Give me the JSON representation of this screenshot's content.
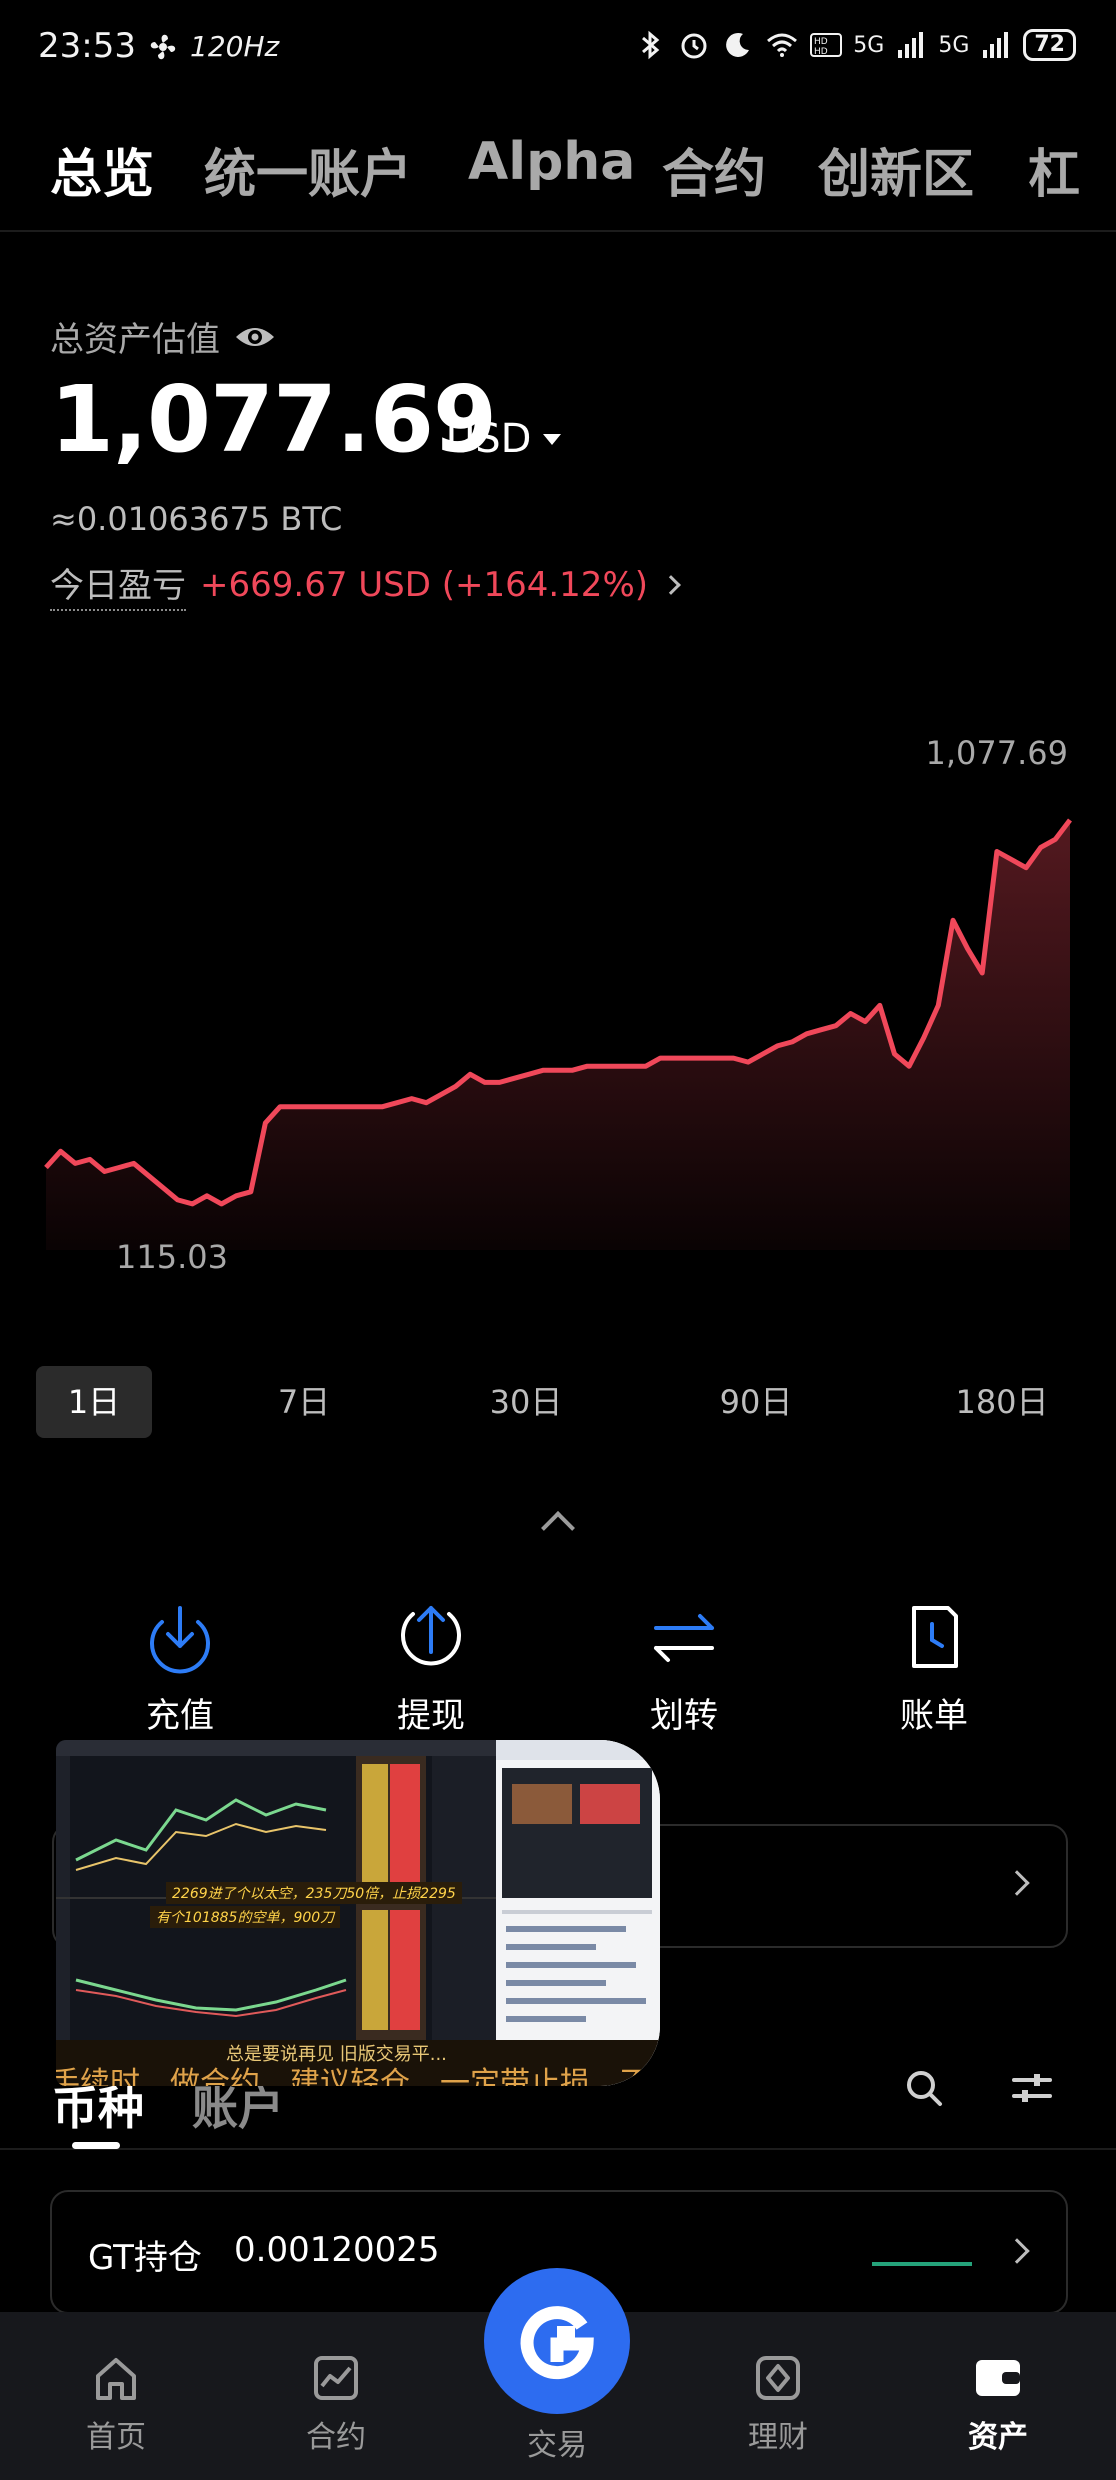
{
  "status_bar": {
    "time": "23:53",
    "refresh_rate": "120Hz",
    "network_1": "5G",
    "network_2": "5G",
    "battery": "72"
  },
  "top_tabs": [
    {
      "label": "总览"
    },
    {
      "label": "统一账户"
    },
    {
      "label": "Alpha"
    },
    {
      "label": "合约"
    },
    {
      "label": "创新区"
    },
    {
      "label": "杠"
    }
  ],
  "overview": {
    "total_label": "总资产估值",
    "total_value": "1,077.69",
    "currency": "USD",
    "btc_equiv": "≈0.01063675 BTC",
    "pnl_label": "今日盈亏",
    "pnl_value": "+669.67 USD (+164.12%)"
  },
  "chart_data": {
    "type": "area",
    "max_label": "1,077.69",
    "min_label": "115.03",
    "color": "#f0485a",
    "grid": false,
    "y": [
      220,
      260,
      230,
      240,
      210,
      220,
      230,
      200,
      170,
      140,
      130,
      150,
      130,
      150,
      160,
      330,
      370,
      370,
      370,
      370,
      370,
      370,
      370,
      370,
      380,
      390,
      380,
      400,
      420,
      450,
      430,
      430,
      440,
      450,
      460,
      460,
      460,
      470,
      470,
      470,
      470,
      470,
      490,
      490,
      490,
      490,
      490,
      490,
      480,
      500,
      520,
      530,
      550,
      560,
      570,
      600,
      580,
      620,
      500,
      470,
      540,
      620,
      830,
      760,
      700,
      1000,
      980,
      960,
      1010,
      1030,
      1077.69
    ]
  },
  "ranges": [
    {
      "label": "1日"
    },
    {
      "label": "7日"
    },
    {
      "label": "30日"
    },
    {
      "label": "90日"
    },
    {
      "label": "180日"
    }
  ],
  "actions": [
    {
      "label": "充值",
      "icon": "deposit-icon"
    },
    {
      "label": "提现",
      "icon": "withdraw-icon"
    },
    {
      "label": "划转",
      "icon": "transfer-icon"
    },
    {
      "label": "账单",
      "icon": "bill-icon"
    }
  ],
  "pip_overlay": {
    "caption_top": "总是要说再见 旧版交易平...",
    "caption_main": "手续时，做合约，建议轻仓，一定带止损，不扛单，...",
    "note_1": "2269进了个以太空，235刀50倍，止损2295",
    "note_2": "有个101885的空单，900刀"
  },
  "subtabs": [
    {
      "label": "币种"
    },
    {
      "label": "账户"
    }
  ],
  "gt_holding": {
    "label": "GT持仓",
    "amount": "0.00120025"
  },
  "bottom_nav": [
    {
      "label": "首页",
      "icon": "home-icon"
    },
    {
      "label": "合约",
      "icon": "futures-icon"
    },
    {
      "label": "交易",
      "icon": "trade-icon"
    },
    {
      "label": "理财",
      "icon": "earn-icon"
    },
    {
      "label": "资产",
      "icon": "wallet-icon"
    }
  ]
}
